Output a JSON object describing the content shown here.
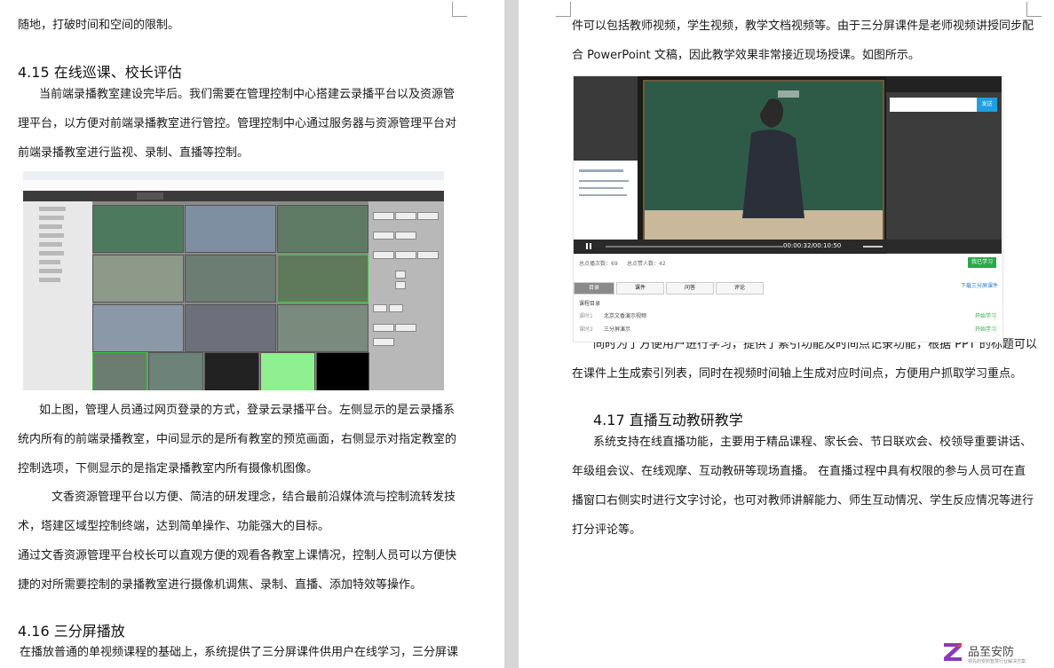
{
  "left_page": {
    "line_top": "随地，打破时间和空间的限制。",
    "h415": "4.15  在线巡课、校长评估",
    "p1": [
      "当前端录播教室建设完毕后。我们需要在管理控制中心搭建云录播平台以及资源管",
      "理平台，以方便对前端录播教室进行管控。管理控制中心通过服务器与资源管理平台对",
      "前端录播教室进行监视、录制、直播等控制。"
    ],
    "p2": [
      "如上图，管理人员通过网页登录的方式，登录云录播平台。左侧显示的是云录播系",
      "统内所有的前端录播教室，中间显示的是所有教室的预览画面，右侧显示对指定教室的",
      "控制选项，下侧显示的是指定录播教室内所有摄像机图像。"
    ],
    "p3": [
      "文香资源管理平台以方便、简洁的研发理念，结合最前沿媒体流与控制流转发技",
      "术，塔建区域型控制终端，达到简单操作、功能强大的目标。"
    ],
    "p4": [
      "通过文香资源管理平台校长可以直观方便的观看各教室上课情况，控制人员可以方便快",
      "捷的对所需要控制的录播教室进行摄像机调焦、录制、直播、添加特效等操作。"
    ],
    "h416": "4.16  三分屏播放",
    "p5": "在播放普通的单视频课程的基础上，系统提供了三分屏课件供用户在线学习，三分屏课"
  },
  "right_page": {
    "p1": [
      "件可以包括教师视频，学生视频，教学文档视频等。由于三分屏课件是老师视频讲授同步配",
      "合 PowerPoint 文稿，因此教学效果非常接近现场授课。如图所示。"
    ],
    "p2": [
      "同时为了方便用户进行学习，提供了索引功能及时间点记录功能，根据 PPT 的标题可以",
      "在课件上生成索引列表，同时在视频时间轴上生成对应时间点，方便用户抓取学习重点。"
    ],
    "h417": "4.17  直播互动教研教学",
    "p3": [
      "系统支持在线直播功能，主要用于精品课程、家长会、节日联欢会、校领导重要讲话、",
      "年级组会议、在线观摩、互动教研等现场直播。 在直播过程中具有权限的参与人员可在直",
      "播窗口右侧实时进行文字讨论，也可对教师讲解能力、师生互动情况、学生反应情况等进行",
      "打分评论等。"
    ]
  },
  "player": {
    "time": "00:00:32/00:10:50",
    "stats_left": "总点播次数：69",
    "stats_right": "总点赞人数：42",
    "start_btn": "我已学习",
    "send_btn": "发送",
    "tabs": [
      "目录",
      "课件",
      "问答",
      "评论"
    ],
    "download": "下载三分屏课件",
    "catalog_title": "课程目录",
    "rows": [
      {
        "idx": "课时1",
        "name": "北京文香演示视频",
        "action": "开始学习"
      },
      {
        "idx": "课时2",
        "name": "三分屏演示",
        "action": "开始学习"
      }
    ]
  },
  "watermark": {
    "name": "品至安防",
    "sub": "领先的安防智慧行业解决方案"
  },
  "colors": {
    "accent_green": "#2aa84a",
    "accent_blue": "#1e9fe0"
  }
}
